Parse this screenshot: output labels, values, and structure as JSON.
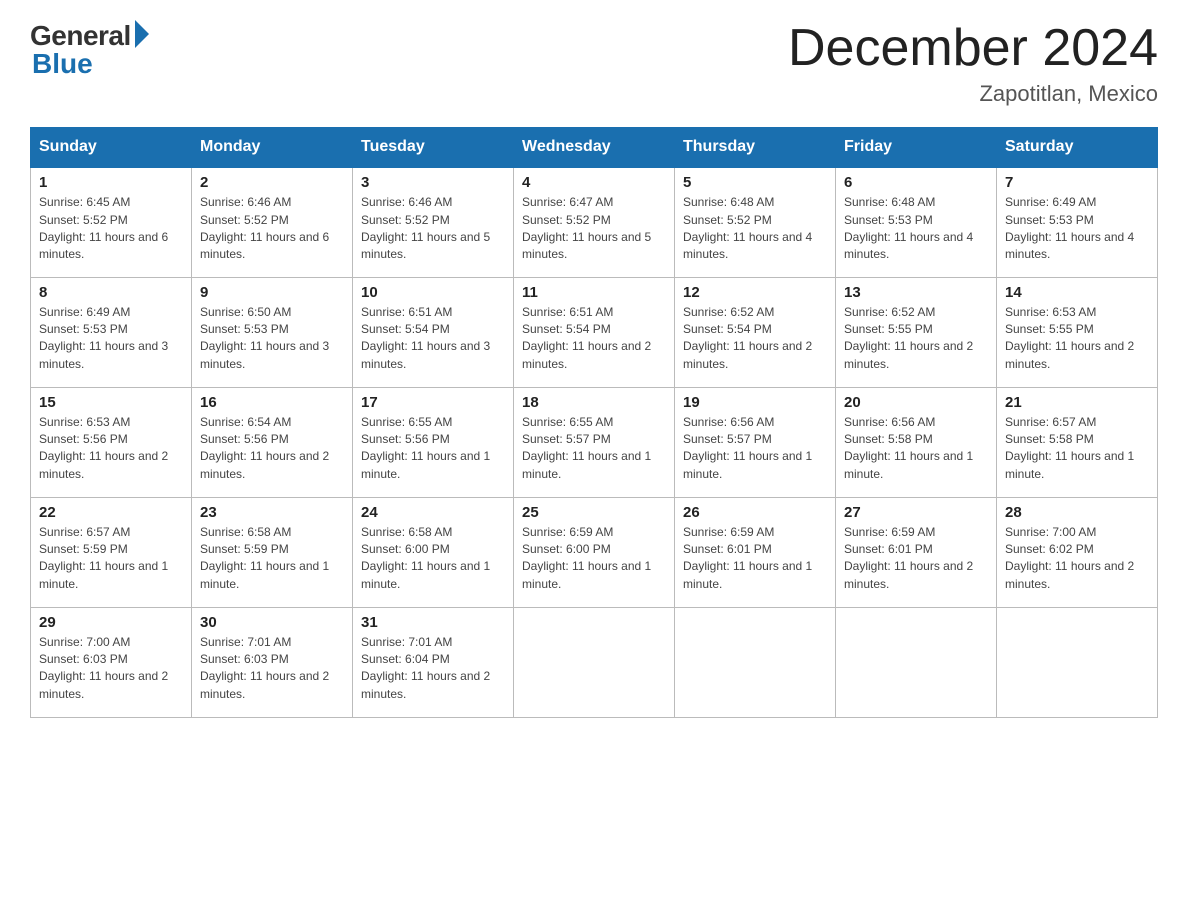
{
  "logo": {
    "general": "General",
    "blue": "Blue"
  },
  "title": "December 2024",
  "location": "Zapotitlan, Mexico",
  "days_of_week": [
    "Sunday",
    "Monday",
    "Tuesday",
    "Wednesday",
    "Thursday",
    "Friday",
    "Saturday"
  ],
  "weeks": [
    [
      {
        "day": "1",
        "sunrise": "6:45 AM",
        "sunset": "5:52 PM",
        "daylight": "11 hours and 6 minutes."
      },
      {
        "day": "2",
        "sunrise": "6:46 AM",
        "sunset": "5:52 PM",
        "daylight": "11 hours and 6 minutes."
      },
      {
        "day": "3",
        "sunrise": "6:46 AM",
        "sunset": "5:52 PM",
        "daylight": "11 hours and 5 minutes."
      },
      {
        "day": "4",
        "sunrise": "6:47 AM",
        "sunset": "5:52 PM",
        "daylight": "11 hours and 5 minutes."
      },
      {
        "day": "5",
        "sunrise": "6:48 AM",
        "sunset": "5:52 PM",
        "daylight": "11 hours and 4 minutes."
      },
      {
        "day": "6",
        "sunrise": "6:48 AM",
        "sunset": "5:53 PM",
        "daylight": "11 hours and 4 minutes."
      },
      {
        "day": "7",
        "sunrise": "6:49 AM",
        "sunset": "5:53 PM",
        "daylight": "11 hours and 4 minutes."
      }
    ],
    [
      {
        "day": "8",
        "sunrise": "6:49 AM",
        "sunset": "5:53 PM",
        "daylight": "11 hours and 3 minutes."
      },
      {
        "day": "9",
        "sunrise": "6:50 AM",
        "sunset": "5:53 PM",
        "daylight": "11 hours and 3 minutes."
      },
      {
        "day": "10",
        "sunrise": "6:51 AM",
        "sunset": "5:54 PM",
        "daylight": "11 hours and 3 minutes."
      },
      {
        "day": "11",
        "sunrise": "6:51 AM",
        "sunset": "5:54 PM",
        "daylight": "11 hours and 2 minutes."
      },
      {
        "day": "12",
        "sunrise": "6:52 AM",
        "sunset": "5:54 PM",
        "daylight": "11 hours and 2 minutes."
      },
      {
        "day": "13",
        "sunrise": "6:52 AM",
        "sunset": "5:55 PM",
        "daylight": "11 hours and 2 minutes."
      },
      {
        "day": "14",
        "sunrise": "6:53 AM",
        "sunset": "5:55 PM",
        "daylight": "11 hours and 2 minutes."
      }
    ],
    [
      {
        "day": "15",
        "sunrise": "6:53 AM",
        "sunset": "5:56 PM",
        "daylight": "11 hours and 2 minutes."
      },
      {
        "day": "16",
        "sunrise": "6:54 AM",
        "sunset": "5:56 PM",
        "daylight": "11 hours and 2 minutes."
      },
      {
        "day": "17",
        "sunrise": "6:55 AM",
        "sunset": "5:56 PM",
        "daylight": "11 hours and 1 minute."
      },
      {
        "day": "18",
        "sunrise": "6:55 AM",
        "sunset": "5:57 PM",
        "daylight": "11 hours and 1 minute."
      },
      {
        "day": "19",
        "sunrise": "6:56 AM",
        "sunset": "5:57 PM",
        "daylight": "11 hours and 1 minute."
      },
      {
        "day": "20",
        "sunrise": "6:56 AM",
        "sunset": "5:58 PM",
        "daylight": "11 hours and 1 minute."
      },
      {
        "day": "21",
        "sunrise": "6:57 AM",
        "sunset": "5:58 PM",
        "daylight": "11 hours and 1 minute."
      }
    ],
    [
      {
        "day": "22",
        "sunrise": "6:57 AM",
        "sunset": "5:59 PM",
        "daylight": "11 hours and 1 minute."
      },
      {
        "day": "23",
        "sunrise": "6:58 AM",
        "sunset": "5:59 PM",
        "daylight": "11 hours and 1 minute."
      },
      {
        "day": "24",
        "sunrise": "6:58 AM",
        "sunset": "6:00 PM",
        "daylight": "11 hours and 1 minute."
      },
      {
        "day": "25",
        "sunrise": "6:59 AM",
        "sunset": "6:00 PM",
        "daylight": "11 hours and 1 minute."
      },
      {
        "day": "26",
        "sunrise": "6:59 AM",
        "sunset": "6:01 PM",
        "daylight": "11 hours and 1 minute."
      },
      {
        "day": "27",
        "sunrise": "6:59 AM",
        "sunset": "6:01 PM",
        "daylight": "11 hours and 2 minutes."
      },
      {
        "day": "28",
        "sunrise": "7:00 AM",
        "sunset": "6:02 PM",
        "daylight": "11 hours and 2 minutes."
      }
    ],
    [
      {
        "day": "29",
        "sunrise": "7:00 AM",
        "sunset": "6:03 PM",
        "daylight": "11 hours and 2 minutes."
      },
      {
        "day": "30",
        "sunrise": "7:01 AM",
        "sunset": "6:03 PM",
        "daylight": "11 hours and 2 minutes."
      },
      {
        "day": "31",
        "sunrise": "7:01 AM",
        "sunset": "6:04 PM",
        "daylight": "11 hours and 2 minutes."
      },
      null,
      null,
      null,
      null
    ]
  ]
}
